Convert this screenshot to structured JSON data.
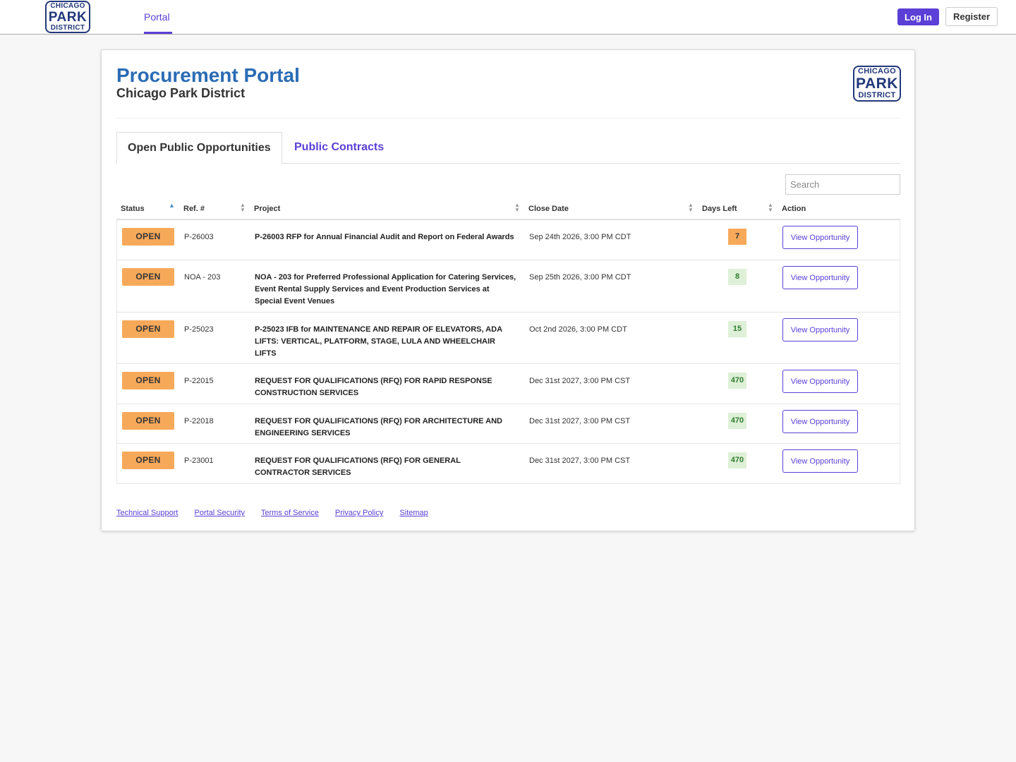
{
  "nav": {
    "logo": {
      "line1": "CHICAGO",
      "line2": "PARK",
      "line3": "DISTRICT"
    },
    "portal_link": "Portal",
    "login_label": "Log In",
    "register_label": "Register"
  },
  "header": {
    "title": "Procurement Portal",
    "subtitle": "Chicago Park District",
    "logo": {
      "line1": "CHICAGO",
      "line2": "PARK",
      "line3": "DISTRICT"
    }
  },
  "tabs": [
    {
      "label": "Open Public Opportunities",
      "active": true
    },
    {
      "label": "Public Contracts",
      "active": false
    }
  ],
  "search": {
    "placeholder": "Search",
    "value": ""
  },
  "table": {
    "columns": [
      "Status",
      "Ref. #",
      "Project",
      "Close Date",
      "Days Left",
      "Action"
    ],
    "sort_column": "Status",
    "rows": [
      {
        "status": "OPEN",
        "ref": "P-26003",
        "project": "P-26003 RFP for Annual Financial Audit and Report on Federal Awards",
        "close_date": "Sep 24th 2026, 3:00 PM CDT",
        "days_left": "7",
        "days_level": "warn",
        "action": "View Opportunity"
      },
      {
        "status": "OPEN",
        "ref": "NOA - 203",
        "project": "NOA - 203 for Preferred Professional Application for Catering Services, Event Rental Supply Services and Event Production Services at Special Event Venues",
        "close_date": "Sep 25th 2026, 3:00 PM CDT",
        "days_left": "8",
        "days_level": "ok",
        "action": "View Opportunity"
      },
      {
        "status": "OPEN",
        "ref": "P-25023",
        "project": "P-25023 IFB for MAINTENANCE AND REPAIR OF ELEVATORS, ADA LIFTS: VERTICAL, PLATFORM, STAGE, LULA AND WHEELCHAIR LIFTS",
        "close_date": "Oct 2nd 2026, 3:00 PM CDT",
        "days_left": "15",
        "days_level": "ok",
        "action": "View Opportunity"
      },
      {
        "status": "OPEN",
        "ref": "P-22015",
        "project": "REQUEST FOR QUALIFICATIONS (RFQ) FOR RAPID RESPONSE CONSTRUCTION SERVICES",
        "close_date": "Dec 31st 2027, 3:00 PM CST",
        "days_left": "470",
        "days_level": "ok",
        "action": "View Opportunity"
      },
      {
        "status": "OPEN",
        "ref": "P-22018",
        "project": "REQUEST FOR QUALIFICATIONS (RFQ) FOR ARCHITECTURE AND ENGINEERING SERVICES",
        "close_date": "Dec 31st 2027, 3:00 PM CST",
        "days_left": "470",
        "days_level": "ok",
        "action": "View Opportunity"
      },
      {
        "status": "OPEN",
        "ref": "P-23001",
        "project": "REQUEST FOR QUALIFICATIONS (RFQ) FOR GENERAL CONTRACTOR SERVICES",
        "close_date": "Dec 31st 2027, 3:00 PM CST",
        "days_left": "470",
        "days_level": "ok",
        "action": "View Opportunity"
      }
    ]
  },
  "footer": {
    "links": [
      "Technical Support",
      "Portal Security",
      "Terms of Service",
      "Privacy Policy",
      "Sitemap"
    ]
  },
  "colors": {
    "accent": "#5b3fd6",
    "title_blue": "#2a6bb5",
    "open_badge": "#f7a95a",
    "days_ok_bg": "#dff0d8",
    "days_ok_text": "#2e7d32",
    "logo_navy": "#22387a"
  }
}
